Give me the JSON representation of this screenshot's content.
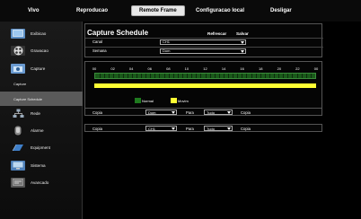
{
  "nav": {
    "tabs": [
      {
        "label": "Vivo"
      },
      {
        "label": "Reproducao"
      },
      {
        "label": "Remote Frame"
      },
      {
        "label": "Configuracao local"
      },
      {
        "label": "Desligar"
      }
    ]
  },
  "sidebar": {
    "items": [
      {
        "label": "Exibicao"
      },
      {
        "label": "Gravacao"
      },
      {
        "label": "Capture"
      },
      {
        "label": "Capture"
      },
      {
        "label": "Capture Schedule"
      },
      {
        "label": "Rede"
      },
      {
        "label": "Alarme"
      },
      {
        "label": "Equipment"
      },
      {
        "label": "Sistema"
      },
      {
        "label": "Avancado"
      }
    ]
  },
  "panel": {
    "title": "Capture Schedule",
    "refresh_label": "Refrescar",
    "save_label": "Salvar",
    "canal_label": "Canal",
    "canal_value": "CH1",
    "semana_label": "Semana",
    "semana_value": "Dom"
  },
  "timeline": {
    "hours": [
      "00",
      "02",
      "04",
      "06",
      "08",
      "10",
      "12",
      "14",
      "16",
      "18",
      "20",
      "22",
      "00"
    ],
    "legend_normal": "Normal",
    "legend_motion": "Movim",
    "normal_color": "#1f7a1f",
    "motion_color": "#ffff33"
  },
  "copy1": {
    "label": "Copia",
    "from_value": "Dom",
    "para_label": "Para",
    "to_value": "Tudo",
    "button": "Copia"
  },
  "copy2": {
    "label": "Copia",
    "from_value": "CH1",
    "para_label": "Para",
    "to_value": "Tudo",
    "button": "Copia"
  }
}
